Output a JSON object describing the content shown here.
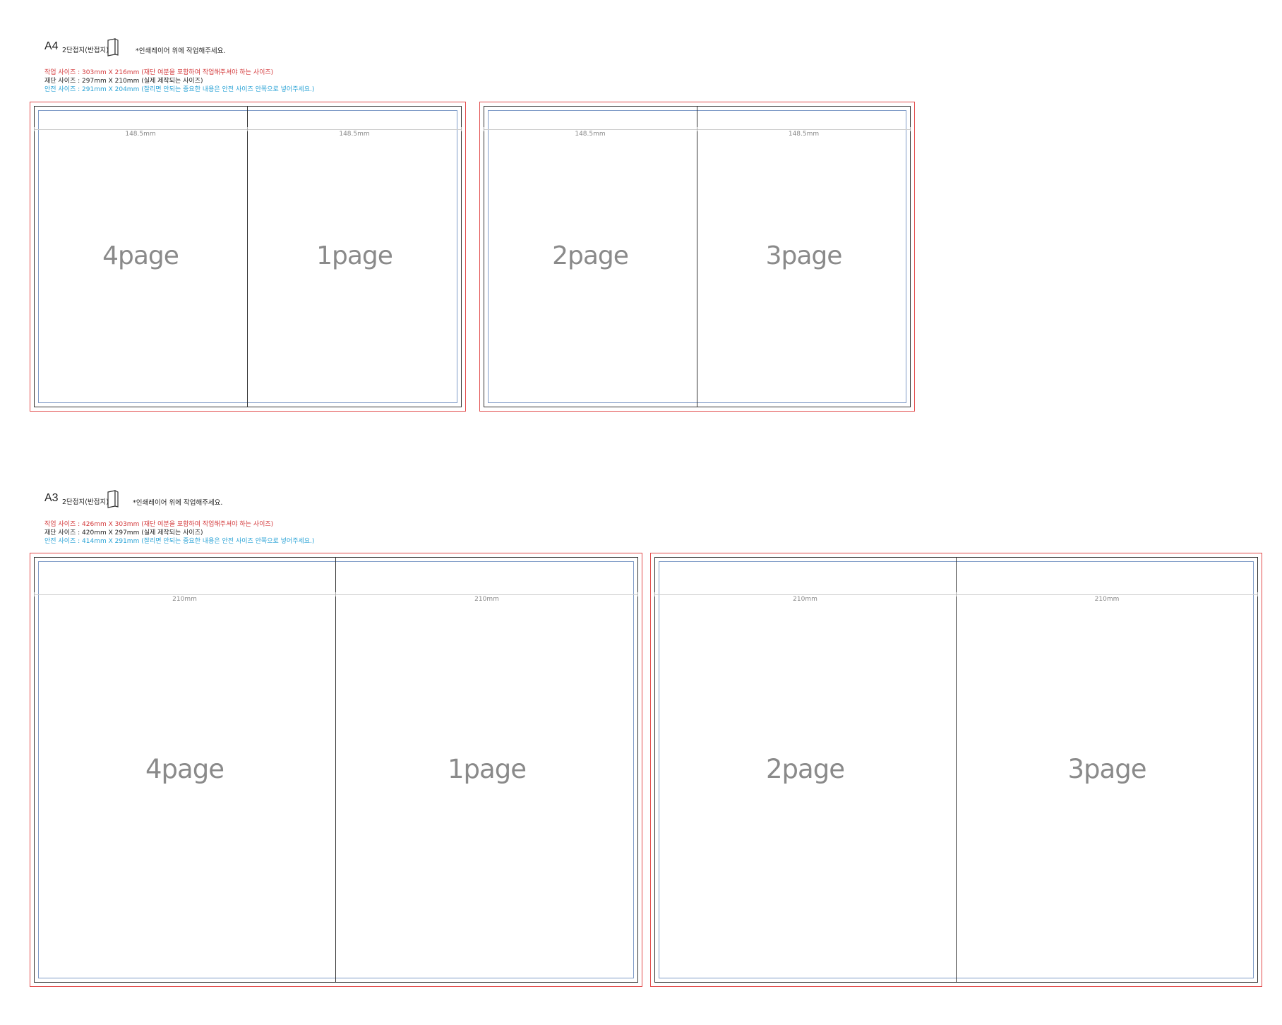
{
  "a4": {
    "title": "A4",
    "subtitle": "2단접지(반접지)",
    "note": "*인쇄레이어 위에 작업해주세요.",
    "work_label": "작업 사이즈 :",
    "work_value": "303mm X 216mm",
    "work_desc": "(재단 여분을 포함하여 작업해주셔야 하는 사이즈)",
    "cut_label": "재단 사이즈 :",
    "cut_value": "297mm X 210mm",
    "cut_desc": "(실제 제작되는 사이즈)",
    "safe_label": "안전 사이즈 :",
    "safe_value": "291mm X 204mm",
    "safe_desc": "(잘리면 안되는 중요한 내용은 안전 사이즈 안쪽으로 넣어주세요.)",
    "spreads": [
      {
        "left_width": "148.5mm",
        "right_width": "148.5mm",
        "left_page": "4page",
        "right_page": "1page"
      },
      {
        "left_width": "148.5mm",
        "right_width": "148.5mm",
        "left_page": "2page",
        "right_page": "3page"
      }
    ]
  },
  "a3": {
    "title": "A3",
    "subtitle": "2단접지(반접지)",
    "note": "*인쇄레이어 위에 작업해주세요.",
    "work_label": "작업 사이즈 :",
    "work_value": "426mm X 303mm",
    "work_desc": "(재단 여분을 포함하여 작업해주셔야 하는 사이즈)",
    "cut_label": "재단 사이즈 :",
    "cut_value": "420mm X 297mm",
    "cut_desc": "(실제 제작되는 사이즈)",
    "safe_label": "안전 사이즈 :",
    "safe_value": "414mm X 291mm",
    "safe_desc": "(잘리면 안되는 중요한 내용은 안전 사이즈 안쪽으로 넣어주세요.)",
    "spreads": [
      {
        "left_width": "210mm",
        "right_width": "210mm",
        "left_page": "4page",
        "right_page": "1page"
      },
      {
        "left_width": "210mm",
        "right_width": "210mm",
        "left_page": "2page",
        "right_page": "3page"
      }
    ]
  },
  "colors": {
    "work": "#d3383a",
    "cut": "#222222",
    "safe": "#2aa3d6",
    "safe_line": "#7f9bc7"
  },
  "icons": {
    "fold": "folded-sheet-icon"
  }
}
